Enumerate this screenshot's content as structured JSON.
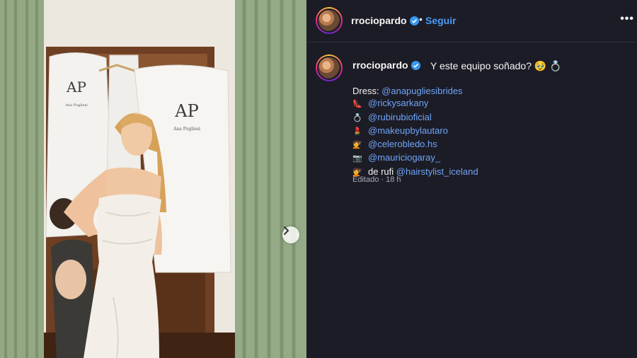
{
  "post": {
    "username": "rrociopardo",
    "separator": "•",
    "follow_label": "Seguir",
    "more_label": "•••",
    "caption_text": "Y este equipo soñado? 🥹 💍",
    "caption_lines": [
      {
        "emoji": "",
        "prefix": "Dress: ",
        "handle": "@anapugliesibrides"
      },
      {
        "emoji": "👠",
        "prefix": "",
        "handle": "@rickysarkany"
      },
      {
        "emoji": "💍",
        "prefix": "",
        "handle": "@rubirubioficial"
      },
      {
        "emoji": "💄",
        "prefix": "",
        "handle": "@makeupbylautaro"
      },
      {
        "emoji": "💇",
        "prefix": "",
        "handle": "@celerobledo.hs"
      },
      {
        "emoji": "📷",
        "prefix": "",
        "handle": "@mauriciogaray_"
      },
      {
        "emoji": "💇",
        "prefix": "de rufi ",
        "handle": "@hairstylist_iceland"
      }
    ],
    "meta": "Editado · 18 h"
  },
  "photo": {
    "bag_logo": "AP",
    "bag_brand": "Ana Pugliesi"
  },
  "colors": {
    "panel_bg": "#1c1c26",
    "link": "#6fa5f7",
    "follow": "#4a9af5",
    "verified": "#3897f0"
  }
}
